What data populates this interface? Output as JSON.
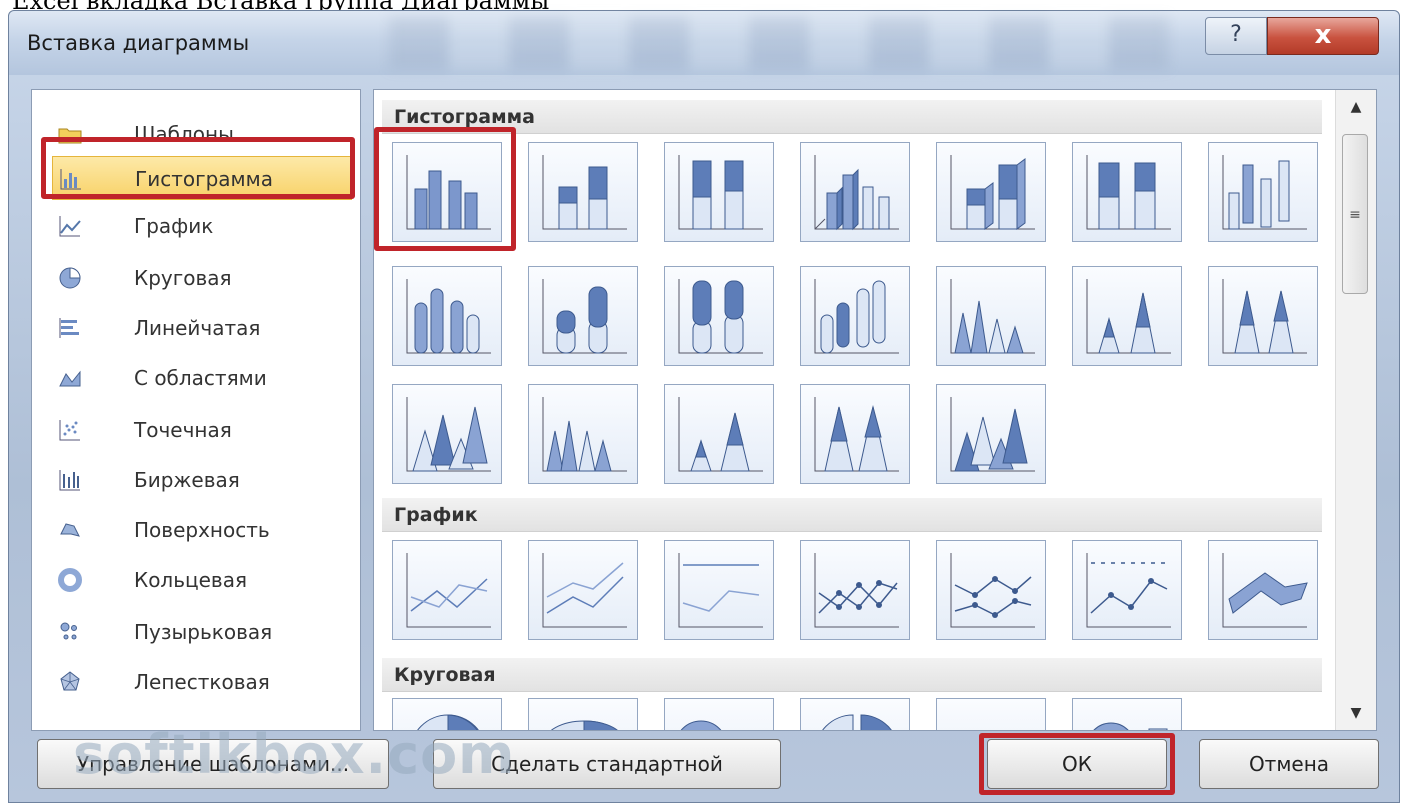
{
  "document": {
    "top_text": "Excel вкладка Вставка группа Диаграммы"
  },
  "dialog": {
    "title": "Вставка диаграммы",
    "help_label": "?",
    "close_label": "x"
  },
  "categories": [
    {
      "label": "Шаблоны",
      "icon": "folder-icon"
    },
    {
      "label": "Гистограмма",
      "icon": "column-chart-icon",
      "selected": true
    },
    {
      "label": "График",
      "icon": "line-chart-icon"
    },
    {
      "label": "Круговая",
      "icon": "pie-chart-icon"
    },
    {
      "label": "Линейчатая",
      "icon": "bar-chart-icon"
    },
    {
      "label": "С областями",
      "icon": "area-chart-icon"
    },
    {
      "label": "Точечная",
      "icon": "scatter-chart-icon"
    },
    {
      "label": "Биржевая",
      "icon": "stock-chart-icon"
    },
    {
      "label": "Поверхность",
      "icon": "surface-chart-icon"
    },
    {
      "label": "Кольцевая",
      "icon": "doughnut-chart-icon"
    },
    {
      "label": "Пузырьковая",
      "icon": "bubble-chart-icon"
    },
    {
      "label": "Лепестковая",
      "icon": "radar-chart-icon"
    }
  ],
  "sections": [
    {
      "title": "Гистограмма"
    },
    {
      "title": "График"
    },
    {
      "title": "Круговая"
    }
  ],
  "scroll": {
    "up": "▲",
    "down": "▼",
    "thumb": "≡"
  },
  "buttons": {
    "manage_templates": "Управление шаблонами...",
    "set_default": "Сделать стандартной",
    "ok": "ОК",
    "cancel": "Отмена"
  },
  "watermark": "softikbox.com"
}
